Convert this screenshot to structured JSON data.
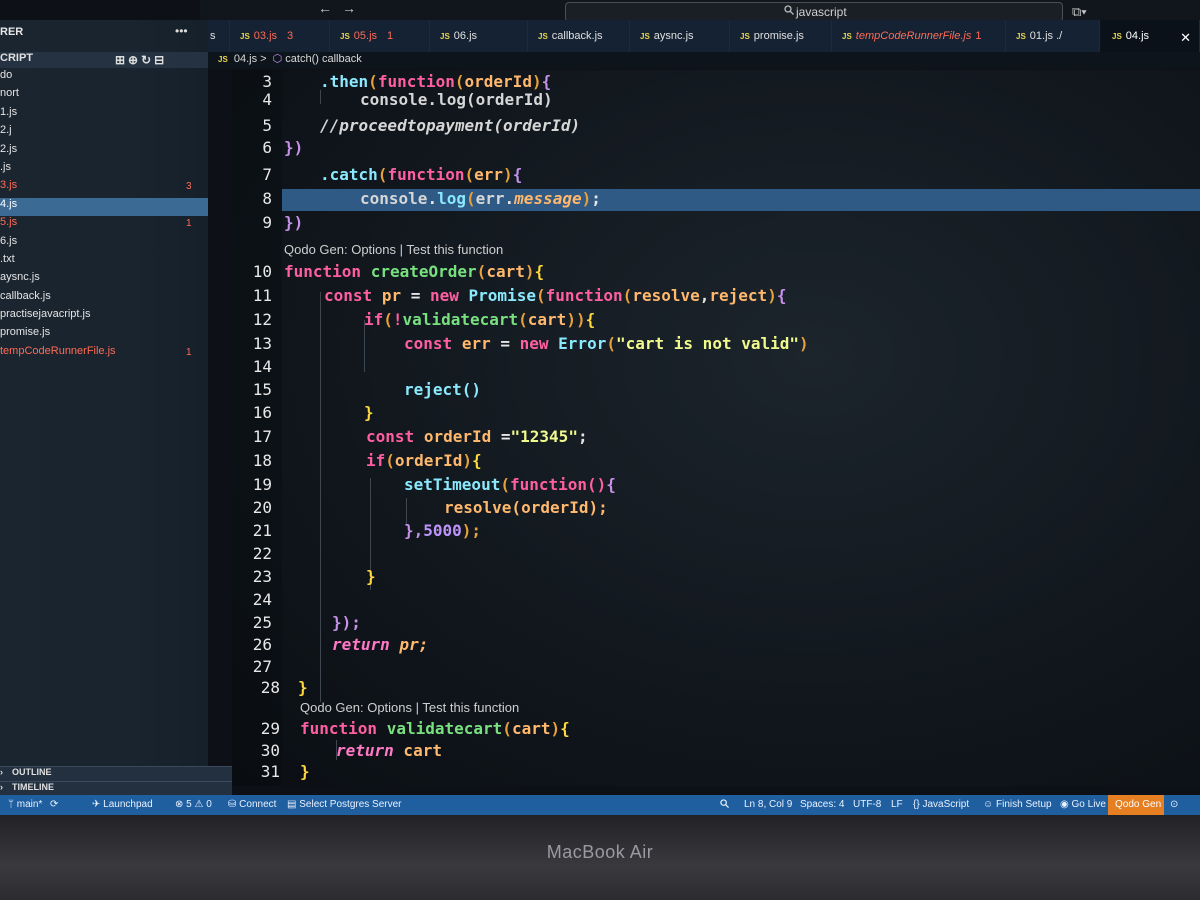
{
  "window": {
    "back_arrow": "←",
    "forward_arrow": "→",
    "search_text": "javascript",
    "search_icon": "magnifier-icon",
    "layout_icon": "⧉▾"
  },
  "sidebar": {
    "title": "RER",
    "more": "•••",
    "section": "CRIPT",
    "actions": "⊞⊕↻⊟",
    "files": [
      {
        "label": "do",
        "state": "normal"
      },
      {
        "label": "nort",
        "state": "normal"
      },
      {
        "label": "1.js",
        "state": "normal"
      },
      {
        "label": "2.j",
        "state": "normal"
      },
      {
        "label": "2.js",
        "state": "normal"
      },
      {
        "label": ".js",
        "state": "normal"
      },
      {
        "label": "3.js",
        "state": "modified",
        "badge": "3"
      },
      {
        "label": "4.js",
        "state": "active"
      },
      {
        "label": "5.js",
        "state": "modified",
        "badge": "1"
      },
      {
        "label": "6.js",
        "state": "normal"
      },
      {
        "label": ".txt",
        "state": "normal"
      },
      {
        "label": "aysnc.js",
        "state": "normal"
      },
      {
        "label": "callback.js",
        "state": "normal"
      },
      {
        "label": "practisejavacript.js",
        "state": "normal"
      },
      {
        "label": "promise.js",
        "state": "normal"
      },
      {
        "label": "tempCodeRunnerFile.js",
        "state": "modified",
        "badge": "1"
      }
    ],
    "outline": "OUTLINE",
    "timeline": "TIMELINE"
  },
  "tabs": [
    {
      "label": "s",
      "count": ""
    },
    {
      "label": "03.js",
      "count": "3",
      "modified": true
    },
    {
      "label": "05.js",
      "count": "1",
      "modified": true
    },
    {
      "label": "06.js",
      "count": ""
    },
    {
      "label": "callback.js",
      "count": ""
    },
    {
      "label": "aysnc.js",
      "count": ""
    },
    {
      "label": "promise.js",
      "count": ""
    },
    {
      "label": "tempCodeRunnerFile.js",
      "count": "1",
      "modified": true
    },
    {
      "label": "01.js ./",
      "count": ""
    },
    {
      "label": "04.js",
      "count": "",
      "active": true
    }
  ],
  "tab_close": "✕",
  "breadcrumb": {
    "file": "04.js",
    "sep": ">",
    "symbol": "catch() callback"
  },
  "code": {
    "lens1": "Qodo Gen: Options | Test this function",
    "lens2": "Qodo Gen: Options | Test this function",
    "lines": {
      "l3": "3",
      "l4": "4",
      "l5": "5",
      "l6": "6",
      "l7": "7",
      "l8": "8",
      "l9": "9",
      "l10": "10",
      "l11": "11",
      "l12": "12",
      "l13": "13",
      "l14": "14",
      "l15": "15",
      "l16": "16",
      "l17": "17",
      "l18": "18",
      "l19": "19",
      "l20": "20",
      "l21": "21",
      "l22": "22",
      "l23": "23",
      "l24": "24",
      "l25": "25",
      "l26": "26",
      "l27": "27",
      "l28": "28",
      "l29": "29",
      "l30": "30",
      "l31": "31"
    },
    "t": {
      "then": ".then",
      "function": "function",
      "lp": "(",
      "rp": ")",
      "orderId": "orderId",
      "lb": "{",
      "rb": "}",
      "console_log_orderid": "console.log(orderId)",
      "comment": "//proceedtopayment(orderId)",
      "close_paren": "})",
      "catch": ".catch",
      "err": "err",
      "console": "console",
      "dot": ".",
      "log": "log",
      "message": "message",
      "semi": ";",
      "createOrder": "createOrder",
      "cart": "cart",
      "const": "const",
      "pr": "pr",
      "eq": " = ",
      "new": "new",
      "Promise": "Promise",
      "resolve": "resolve",
      "comma": ",",
      "reject": "reject",
      "if": "if",
      "not": "!",
      "validatecart": "validatecart",
      "Error": "Error",
      "err_msg": "\"cart is not valid\"",
      "reject_call": "reject()",
      "orderId_val": "\"12345\"",
      "eq2": " =",
      "setTimeout": "setTimeout",
      "fn_empty": "function()",
      "resolve_orderId": "resolve(orderId);",
      "timeout_end": "},",
      "ms": "5000",
      "end_paren_semi": ");",
      "close_all": "});",
      "return": "return",
      "pr_semi": " pr;",
      "return_cart": " cart",
      "space": " "
    }
  },
  "status": {
    "branch": "main*",
    "sync": "⟳",
    "launchpad": "Launchpad",
    "problems": "⊗ 5 ⚠ 0",
    "connect": "Connect",
    "postgres": "Select Postgres Server",
    "zoom": "🔍",
    "position": "Ln 8, Col 9",
    "spaces": "Spaces: 4",
    "encoding": "UTF-8",
    "eol": "LF",
    "language": "{} JavaScript",
    "finish_setup": "Finish Setup",
    "go_live": "Go Live",
    "qodo_gen": "Qodo Gen",
    "bell": "⊙"
  },
  "bezel": {
    "label": "MacBook Air"
  }
}
